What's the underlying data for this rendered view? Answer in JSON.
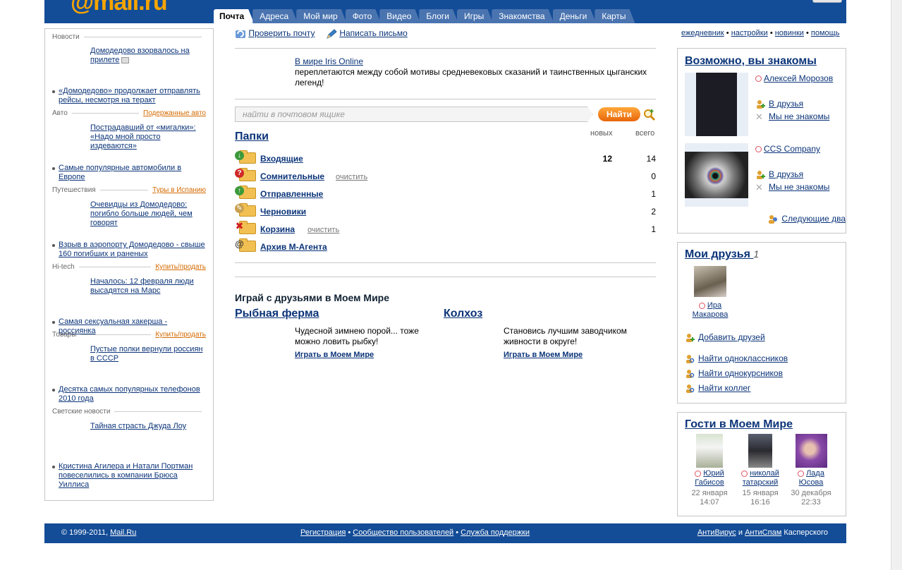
{
  "header": {
    "logo": "@mail.ru",
    "tabs": [
      "Почта",
      "Адреса",
      "Мой мир",
      "Фото",
      "Видео",
      "Блоги",
      "Игры",
      "Знакомства",
      "Деньги",
      "Карты"
    ]
  },
  "left": {
    "news_head": "Новости",
    "news_main": "Домодедово взорвалось на прилете",
    "news_bullet": "«Домодедово» продолжает отправлять рейсы, несмотря на теракт",
    "auto_head": "Авто",
    "auto_link": "Подержанные авто",
    "auto_main": "Пострадавший от «мигалки»: «Надо мной просто издеваются»",
    "auto_bullet": "Самые популярные автомобили в Европе",
    "travel_head": "Путешествия",
    "travel_link": "Туры в Испанию",
    "travel_main": "Очевидцы из Домодедово: погибло больше людей, чем говорят",
    "travel_bullet": "Взрыв в аэропорту Домодедово - свыше 160 погибших и раненых",
    "hitech_head": "Hi-tech",
    "hitech_link": "Купить/продать",
    "hitech_main": "Началось: 12 февраля люди высадятся на Марс",
    "hitech_bullet": "Самая сексуальная хакерша - россиянка",
    "goods_head": "Товары",
    "goods_link": "Купить/продать",
    "goods_main": "Пустые полки вернули россиян в СССР",
    "goods_bullet": "Десятка самых популярных телефонов 2010 года",
    "celeb_head": "Светские новости",
    "celeb_main": "Тайная страсть Джуда Лоу",
    "celeb_bullet": "Кристина Агилера и Натали Портман повеселились в компании Брюса Уиллиса"
  },
  "center": {
    "check_mail": "Проверить почту",
    "write_mail": "Написать письмо",
    "promo_link": "В мире Iris Online",
    "promo_text": "переплетаются между собой мотивы средневековых сказаний и таинственных цыганских легенд!",
    "search_placeholder": "найти в почтовом ящике",
    "search_button": "Найти",
    "folders_title": "Папки",
    "col_new": "новых",
    "col_total": "всего",
    "clean_label": "очистить",
    "folders": [
      {
        "name": "Входящие",
        "new": "12",
        "total": "14"
      },
      {
        "name": "Сомнительные",
        "new": "",
        "total": "0"
      },
      {
        "name": "Отправленные",
        "new": "",
        "total": "1"
      },
      {
        "name": "Черновики",
        "new": "",
        "total": "2"
      },
      {
        "name": "Корзина",
        "new": "",
        "total": "1"
      },
      {
        "name": "Архив М-Агента",
        "new": "",
        "total": ""
      }
    ],
    "games_title": "Играй с друзьями в Моем Мире",
    "games": [
      {
        "name": "Рыбная ферма",
        "desc": "Чудесной зимнею порой... тоже можно ловить рыбку!",
        "play": "Играть в Моем Мире"
      },
      {
        "name": "Колхоз",
        "desc": "Становись лучшим заводчиком живности в округе!",
        "play": "Играть в Моем Мире"
      }
    ]
  },
  "top_right_links": [
    "ежедневник",
    "настройки",
    "новинки",
    "помощь"
  ],
  "maybe_known": {
    "title": "Возможно, вы знакомы",
    "people": [
      {
        "name": "Алексей Морозов",
        "add": "В друзья",
        "reject": "Мы не знакомы"
      },
      {
        "name": "CCS Company",
        "add": "В друзья",
        "reject": "Мы не знакомы"
      }
    ],
    "next": "Следующие два"
  },
  "my_friends": {
    "title": "Мои друзья",
    "count": "1",
    "friend_first": "Ира",
    "friend_last": "Макарова",
    "add_friends": "Добавить друзей",
    "find_classmates": "Найти одноклассников",
    "find_coursemates": "Найти однокурсников",
    "find_colleagues": "Найти коллег"
  },
  "guests": {
    "title": "Гости в Моем Мире",
    "list": [
      {
        "first": "Юрий",
        "last": "Габисов",
        "date": "22 января",
        "time": "14:07"
      },
      {
        "first": "николай",
        "last": "татарский",
        "date": "15 января",
        "time": "16:16"
      },
      {
        "first": "Лада",
        "last": "Юсова",
        "date": "30 декабря",
        "time": "22:33"
      }
    ]
  },
  "footer": {
    "copyright": "© 1999-2011,",
    "copyright_link": "Mail.Ru",
    "register": "Регистрация",
    "community": "Сообщество пользователей",
    "support": "Служба поддержки",
    "antivirus": "АнтиВирус",
    "and": "и",
    "antispam": "АнтиСпам",
    "kaspersky": "Касперского"
  },
  "colors": {
    "brand_blue": "#134c97",
    "link": "#0b3479",
    "orange": "#f07f12"
  }
}
